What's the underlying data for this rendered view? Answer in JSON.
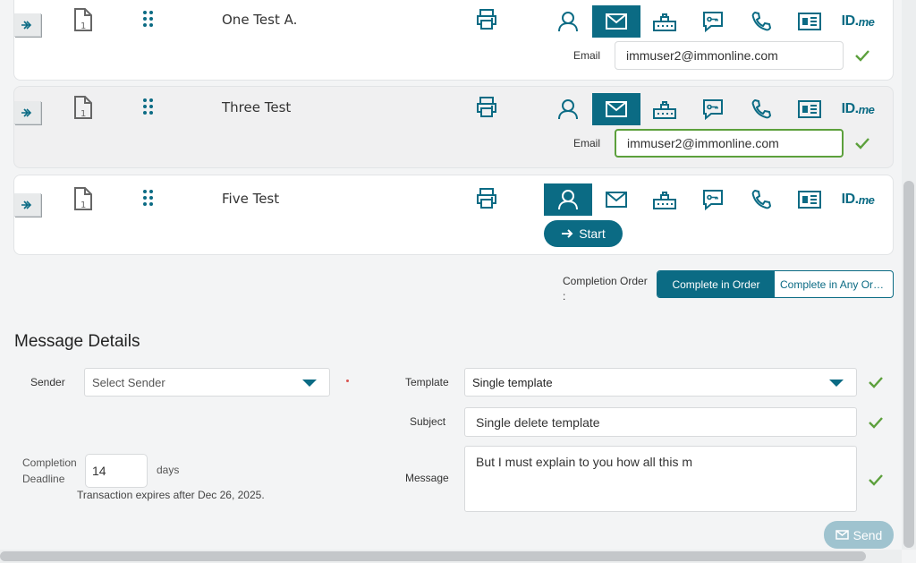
{
  "colors": {
    "accent": "#0b6b84",
    "success": "#5ca03c",
    "send_disabled": "#9fc3cf"
  },
  "signers": [
    {
      "name": "One Test A.",
      "selected_method": "email",
      "email_label": "Email",
      "email_value": "immuser2@immonline.com"
    },
    {
      "name": "Three Test",
      "selected_method": "email",
      "email_label": "Email",
      "email_value": "immuser2@immonline.com"
    },
    {
      "name": "Five Test",
      "selected_method": "in-person",
      "start_label": "Start"
    }
  ],
  "method_icons": [
    "person-icon",
    "envelope-icon",
    "router-icon",
    "chat-key-icon",
    "phone-icon",
    "id-card-icon",
    "idme-logo"
  ],
  "idme": {
    "main": "ID.",
    "suffix": "me"
  },
  "completion_order": {
    "label": "Completion Order",
    "colon": ":",
    "options": [
      "Complete in Order",
      "Complete in Any Order"
    ],
    "selected": "Complete in Order"
  },
  "message_details": {
    "title": "Message Details",
    "sender_label": "Sender",
    "sender_placeholder": "Select Sender",
    "template_label": "Template",
    "template_value": "Single template",
    "subject_label": "Subject",
    "subject_value": "Single delete template",
    "message_label": "Message",
    "message_value": "But I must explain to you how all this m",
    "deadline_label_1": "Completion",
    "deadline_label_2": "Deadline",
    "deadline_value": "14",
    "deadline_unit": "days",
    "expiry_text": "Transaction expires after Dec 26, 2025."
  },
  "send_label": "Send"
}
